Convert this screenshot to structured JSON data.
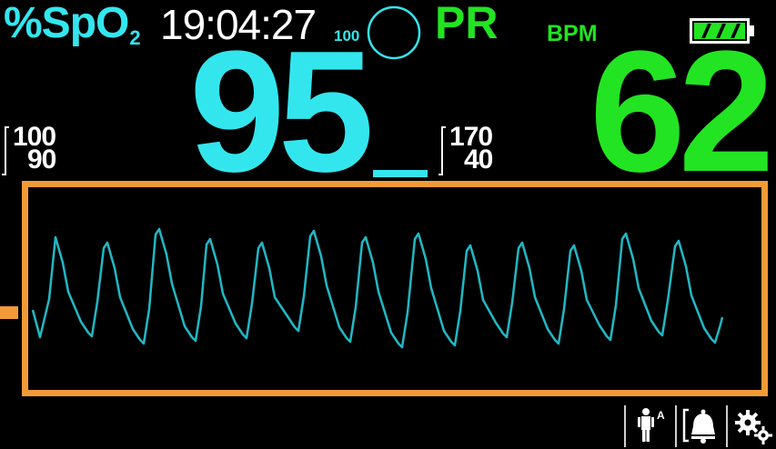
{
  "header": {
    "spo2_label": "%SpO",
    "spo2_sub": "2",
    "time": "19:04:27",
    "pi_scale": "100",
    "pr_label": "PR",
    "bpm_label": "BPM"
  },
  "spo2": {
    "value": "95",
    "limit_high": "100",
    "limit_low": "90"
  },
  "pr": {
    "value": "62",
    "limit_high": "170",
    "limit_low": "40"
  },
  "battery": {
    "level": 1.0
  },
  "colors": {
    "spo2": "#33e6ee",
    "pr": "#22e422",
    "highlight": "#f29a38",
    "waveform": "#21b8c4"
  },
  "toolbar": {
    "patient_mode_label": "A",
    "icons": [
      "patient-adult-icon",
      "alarm-bell-icon",
      "settings-gears-icon"
    ]
  }
}
